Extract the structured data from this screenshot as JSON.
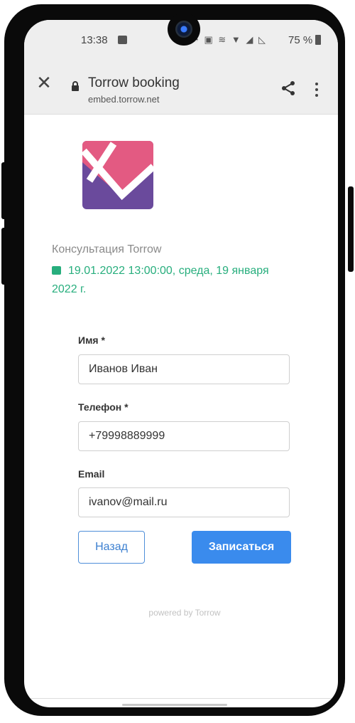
{
  "status_bar": {
    "time": "13:38",
    "battery": "75 %"
  },
  "browser": {
    "title": "Torrow booking",
    "url": "embed.torrow.net"
  },
  "booking": {
    "service": "Консультация Torrow",
    "datetime": "19.01.2022 13:00:00, среда, 19 января 2022 г."
  },
  "form": {
    "name_label": "Имя *",
    "name_value": "Иванов Иван",
    "phone_label": "Телефон *",
    "phone_value": "+79998889999",
    "email_label": "Email",
    "email_value": "ivanov@mail.ru",
    "back_label": "Назад",
    "submit_label": "Записаться"
  },
  "footer": {
    "powered": "powered by Torrow"
  },
  "colors": {
    "accent_green": "#27ae7d",
    "primary_blue": "#3a8bed",
    "logo_pink": "#e35a82",
    "logo_purple": "#6a4a9c"
  },
  "icons": [
    "close-icon",
    "lock-icon",
    "share-icon",
    "more-vert-icon",
    "calendar-icon",
    "image-icon",
    "wifi-icon",
    "signal-icon",
    "battery-icon"
  ]
}
